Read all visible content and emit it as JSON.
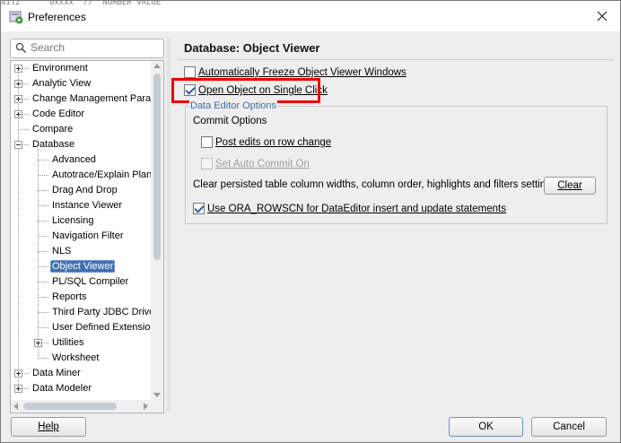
{
  "window": {
    "title": "Preferences",
    "app_icon": "preferences-app-icon",
    "top_strip_text": "ailz      0xxxx  //  NUMBER VALUE"
  },
  "search": {
    "placeholder": "Search",
    "value": ""
  },
  "tree": {
    "items": [
      {
        "label": "Environment",
        "level": 0,
        "expander": "plus"
      },
      {
        "label": "Analytic View",
        "level": 0,
        "expander": "plus"
      },
      {
        "label": "Change Management Paran",
        "level": 0,
        "expander": "plus"
      },
      {
        "label": "Code Editor",
        "level": 0,
        "expander": "plus"
      },
      {
        "label": "Compare",
        "level": 0,
        "expander": "none"
      },
      {
        "label": "Database",
        "level": 0,
        "expander": "minus"
      },
      {
        "label": "Advanced",
        "level": 1,
        "expander": "none"
      },
      {
        "label": "Autotrace/Explain Plan",
        "level": 1,
        "expander": "none"
      },
      {
        "label": "Drag And Drop",
        "level": 1,
        "expander": "none"
      },
      {
        "label": "Instance Viewer",
        "level": 1,
        "expander": "none"
      },
      {
        "label": "Licensing",
        "level": 1,
        "expander": "none"
      },
      {
        "label": "Navigation Filter",
        "level": 1,
        "expander": "none"
      },
      {
        "label": "NLS",
        "level": 1,
        "expander": "none"
      },
      {
        "label": "Object Viewer",
        "level": 1,
        "expander": "none",
        "selected": true
      },
      {
        "label": "PL/SQL Compiler",
        "level": 1,
        "expander": "none"
      },
      {
        "label": "Reports",
        "level": 1,
        "expander": "none"
      },
      {
        "label": "Third Party JDBC Driver",
        "level": 1,
        "expander": "none"
      },
      {
        "label": "User Defined Extension",
        "level": 1,
        "expander": "none"
      },
      {
        "label": "Utilities",
        "level": 1,
        "expander": "plus"
      },
      {
        "label": "Worksheet",
        "level": 1,
        "expander": "none"
      },
      {
        "label": "Data Miner",
        "level": 0,
        "expander": "plus"
      },
      {
        "label": "Data Modeler",
        "level": 0,
        "expander": "plus"
      }
    ]
  },
  "panel": {
    "title": "Database: Object Viewer",
    "auto_freeze": {
      "label": "Automatically Freeze Object Viewer Windows",
      "checked": false
    },
    "open_single_click": {
      "label": "Open Object on Single Click",
      "checked": true
    },
    "group": {
      "legend": "Data Editor Options",
      "commit_label": "Commit Options",
      "post_edits": {
        "label": "Post edits on row change",
        "checked": false
      },
      "auto_commit": {
        "label": "Set Auto Commit On",
        "checked": false,
        "disabled": true
      },
      "clear_text": "Clear persisted table column widths, column order, highlights and filters settings",
      "clear_button": "Clear",
      "rowscn": {
        "label": "Use ORA_ROWSCN for DataEditor insert and update statements",
        "checked": true
      }
    }
  },
  "footer": {
    "help": "Help",
    "ok": "OK",
    "cancel": "Cancel"
  },
  "colors": {
    "selection": "#3f6fb1",
    "highlight_box": "#ee0000",
    "legend_text": "#3b6ea8",
    "checkmark": "#2a5fa8"
  }
}
